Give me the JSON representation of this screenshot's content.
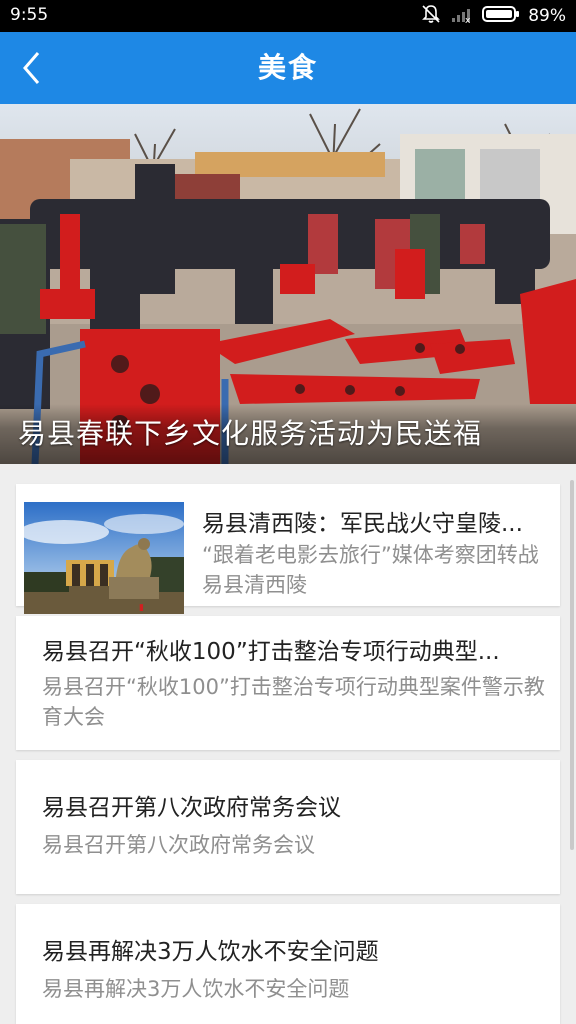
{
  "status_bar": {
    "time": "9:55",
    "battery": "89%",
    "icons": [
      "mute-icon",
      "signal-off-icon",
      "battery-icon"
    ]
  },
  "app_bar": {
    "back_icon": "chevron-left-icon",
    "title": "美食"
  },
  "hero": {
    "caption": "易县春联下乡文化服务活动为民送福"
  },
  "news": [
    {
      "title": "易县清西陵：军民战火守皇陵...",
      "summary": "“跟着老电影去旅行”媒体考察团转战易县清西陵",
      "has_thumbnail": true
    },
    {
      "title": "易县召开“秋收100”打击整治专项行动典型...",
      "summary": "易县召开“秋收100”打击整治专项行动典型案件警示教育大会",
      "has_thumbnail": false
    },
    {
      "title": "易县召开第八次政府常务会议",
      "summary": "易县召开第八次政府常务会议",
      "has_thumbnail": false
    },
    {
      "title": "易县再解决3万人饮水不安全问题",
      "summary": "易县再解决3万人饮水不安全问题",
      "has_thumbnail": false
    }
  ],
  "colors": {
    "app_bar": "#1e88e5",
    "status_bar": "#000000",
    "background": "#eeeeee",
    "card": "#ffffff",
    "summary_text": "#8f8f8f"
  }
}
